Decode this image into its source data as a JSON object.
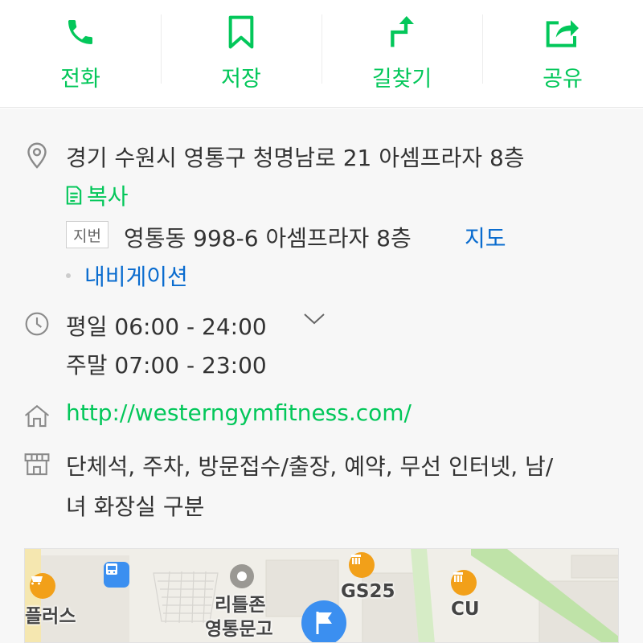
{
  "actions": [
    {
      "id": "call",
      "label": "전화",
      "icon": "phone-icon"
    },
    {
      "id": "save",
      "label": "저장",
      "icon": "bookmark-icon"
    },
    {
      "id": "route",
      "label": "길찾기",
      "icon": "directions-icon"
    },
    {
      "id": "share",
      "label": "공유",
      "icon": "share-icon"
    }
  ],
  "address": {
    "road": "경기 수원시 영통구 청명남로 21 아셈프라자 8층",
    "copy_label": "복사",
    "jibun_badge": "지번",
    "jibun": "영통동 998-6 아셈프라자 8층",
    "map_link": "지도",
    "navigation": "내비게이션"
  },
  "hours": {
    "weekday": "평일 06:00 - 24:00",
    "weekend": "주말 07:00 - 23:00"
  },
  "website": "http://westerngymfitness.com/",
  "amenities": {
    "line1": "단체석, 주차, 방문접수/출장, 예약, 무선 인터넷, 남/",
    "line2": "녀 화장실 구분"
  },
  "map": {
    "labels": {
      "plus": "플러스",
      "littlezone_1": "리틀존",
      "littlezone_2": "영통문고",
      "gs25": "GS25",
      "cu": "CU"
    },
    "colors": {
      "store_poi": "#f2a019",
      "bus_poi": "#3b8ff0",
      "pin": "#3b8ff0",
      "park": "#bfe3a8"
    }
  },
  "colors": {
    "green": "#03c75a",
    "blue": "#0a6ccf"
  }
}
